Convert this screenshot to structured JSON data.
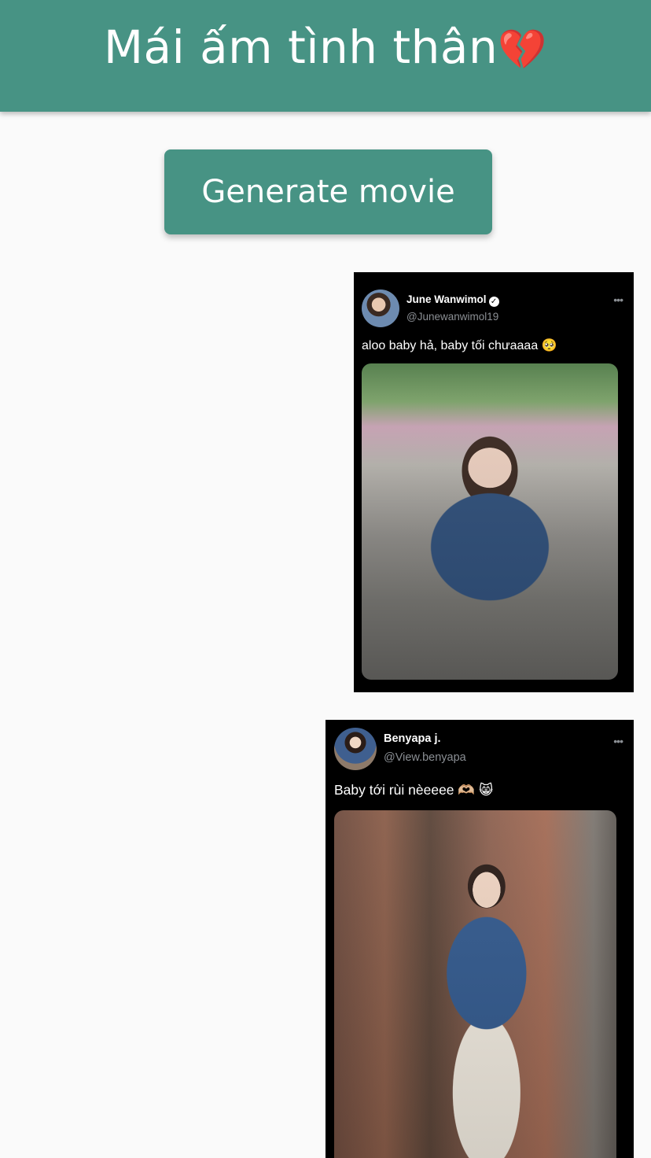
{
  "app_bar": {
    "title": "Mái ấm tình thân",
    "title_emoji": "💔"
  },
  "actions": {
    "generate_label": "Generate movie"
  },
  "tweets": [
    {
      "name": "June Wanwimol",
      "verified": true,
      "handle": "@Junewanwimol19",
      "text": "aloo baby hả, baby tối chưaaaa 🥺",
      "more_icon": "more-horizontal-icon"
    },
    {
      "name": "Benyapa j.",
      "verified": false,
      "handle": "@View.benyapa",
      "text": "Baby tới rùi nèeeee 🫶🏼 😸",
      "more_icon": "more-horizontal-icon"
    }
  ],
  "colors": {
    "primary": "#479384",
    "background": "#fafafa",
    "card": "#000000"
  }
}
